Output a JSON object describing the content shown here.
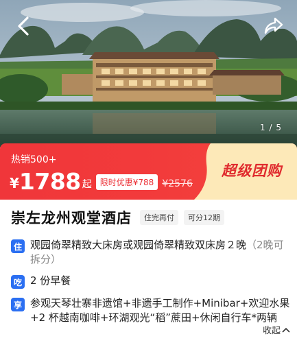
{
  "hero": {
    "pager": "1 / 5",
    "back_icon": "chevron-left-icon",
    "share_icon": "share-arrow-icon"
  },
  "promo": {
    "sales": "热销500+",
    "currency": "¥",
    "price": "1788",
    "price_suffix": "起",
    "discount": "限时优惠¥788",
    "original_price": "¥2576",
    "campaign": "超级团购",
    "colors": {
      "banner": "#f0363a",
      "panel": "#fde9b8",
      "campaign_text": "#e02c2f"
    }
  },
  "hotel": {
    "name": "崇左龙州观堂酒店",
    "tags": [
      "住完再付",
      "可分12期"
    ]
  },
  "package": [
    {
      "badge": "住",
      "text": "观园倚翠精致大床房或观园倚翠精致双床房２晚",
      "note": "（2晚可拆分）"
    },
    {
      "badge": "吃",
      "text": "2 份早餐"
    },
    {
      "badge": "享",
      "text": "参观天琴壮寨非遗馆+非遗手工制作+Minibar+欢迎水果+2 杯越南咖啡+环湖观光“稻”蔗田+休闲自行车*两辆"
    }
  ],
  "collapse_label": "收起",
  "badge_color": "#2b6ff2"
}
